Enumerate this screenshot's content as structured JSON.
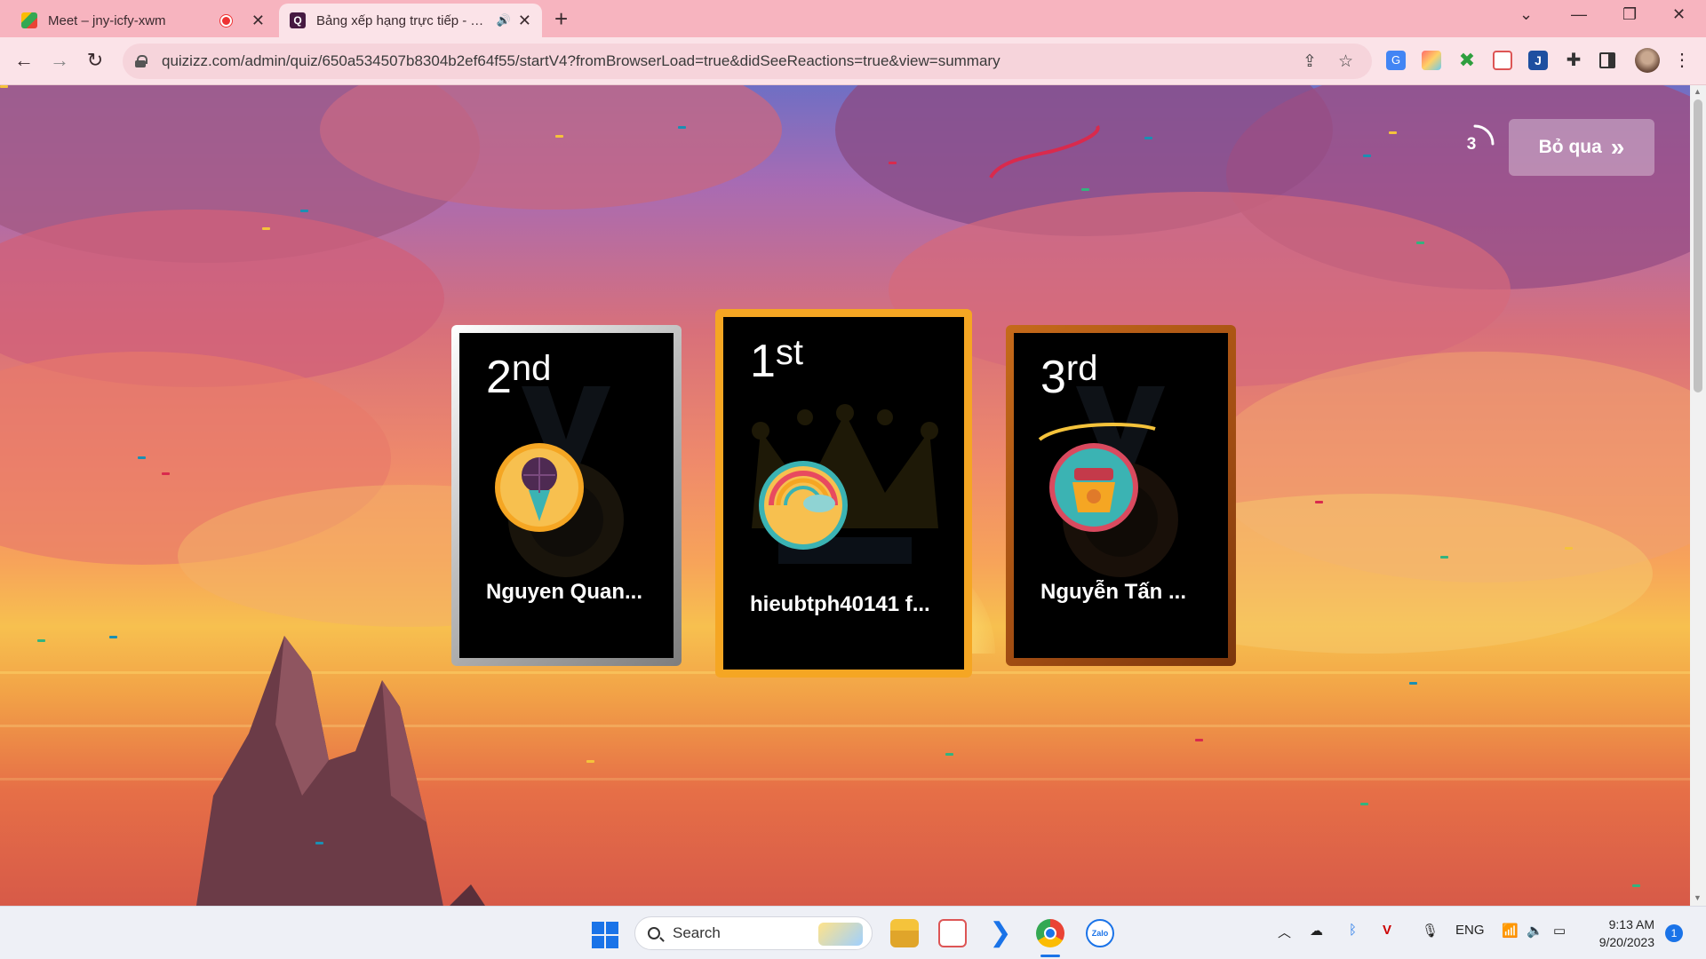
{
  "browser": {
    "tabs": [
      {
        "title": "Meet – jny-icfy-xwm",
        "favicon_color": "#34a853"
      },
      {
        "title": "Bảng xếp hạng trực tiếp - Tổng kết",
        "favicon_color": "#461a42"
      }
    ],
    "url": "quizizz.com/admin/quiz/650a534507b8304b2ef64f55/startV4?fromBrowserLoad=true&didSeeReactions=true&view=summary",
    "icons": [
      "back-icon",
      "forward-icon",
      "reload-icon",
      "share-icon",
      "star-icon",
      "translate-icon",
      "extensions-icon",
      "sidebar-icon",
      "menu-icon"
    ]
  },
  "leaderboard": {
    "countdown": "3",
    "skip_label": "Bỏ qua",
    "skip_icon": "»",
    "podium": [
      {
        "rank_num": "2",
        "rank_suffix": "nd",
        "name": "Nguyen Quan...",
        "border": "silver"
      },
      {
        "rank_num": "1",
        "rank_suffix": "st",
        "name": "hieubtph40141 f...",
        "border": "gold"
      },
      {
        "rank_num": "3",
        "rank_suffix": "rd",
        "name": "Nguyễn Tấn ...",
        "border": "bronze"
      }
    ]
  },
  "taskbar": {
    "search_label": "Search",
    "language": "ENG",
    "time": "9:13 AM",
    "date": "9/20/2023",
    "notification_count": "1",
    "zalo_label": "Zalo"
  }
}
